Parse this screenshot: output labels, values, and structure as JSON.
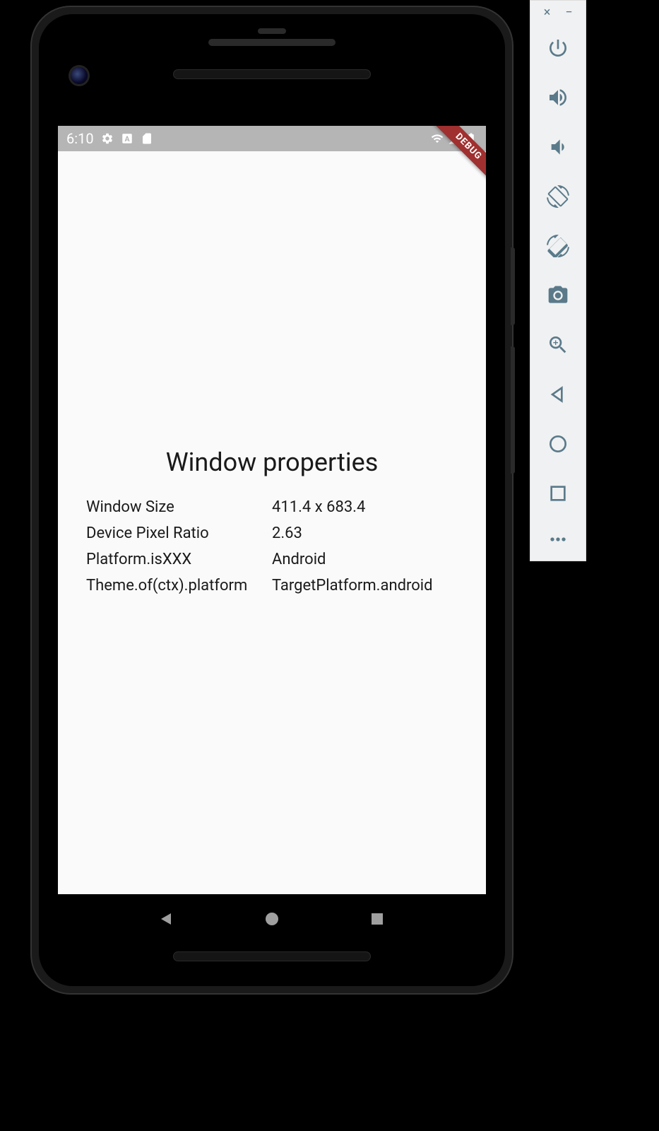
{
  "status_bar": {
    "time": "6:10",
    "icons_left": [
      "settings",
      "a-box",
      "sd-card"
    ],
    "icons_right": [
      "wifi",
      "signal",
      "battery"
    ]
  },
  "debug_banner": "DEBUG",
  "app": {
    "title": "Window properties",
    "properties": [
      {
        "label": "Window Size",
        "value": "411.4 x 683.4"
      },
      {
        "label": "Device Pixel Ratio",
        "value": "2.63"
      },
      {
        "label": "Platform.isXXX",
        "value": "Android"
      },
      {
        "label": "Theme.of(ctx).platform",
        "value": "TargetPlatform.android"
      }
    ]
  },
  "nav_bar": {
    "buttons": [
      "back",
      "home",
      "recents"
    ]
  },
  "emulator_sidebar": {
    "top": {
      "close": "×",
      "minimize": "−"
    },
    "buttons": [
      {
        "name": "power",
        "label": "Power"
      },
      {
        "name": "volume-up",
        "label": "Volume Up"
      },
      {
        "name": "volume-down",
        "label": "Volume Down"
      },
      {
        "name": "rotate-left",
        "label": "Rotate Left"
      },
      {
        "name": "rotate-right",
        "label": "Rotate Right"
      },
      {
        "name": "screenshot",
        "label": "Take Screenshot"
      },
      {
        "name": "zoom",
        "label": "Zoom"
      },
      {
        "name": "back",
        "label": "Back"
      },
      {
        "name": "home",
        "label": "Home"
      },
      {
        "name": "overview",
        "label": "Overview"
      },
      {
        "name": "more",
        "label": "More"
      }
    ]
  }
}
